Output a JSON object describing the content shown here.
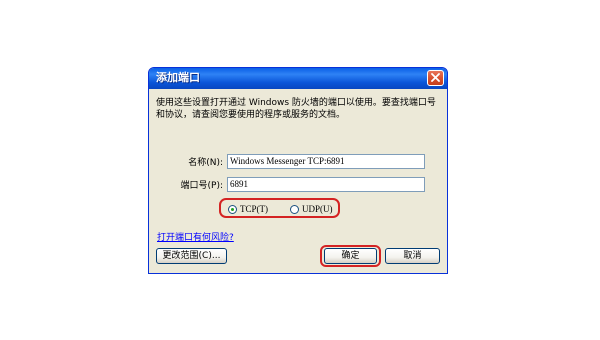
{
  "dialog": {
    "title": "添加端口",
    "description": "使用这些设置打开通过 Windows 防火墙的端口以使用。要查找端口号和协议，请查阅您要使用的程序或服务的文档。",
    "name_label": "名称(N):",
    "name_value": "Windows Messenger TCP:6891",
    "port_label": "端口号(P):",
    "port_value": "6891",
    "tcp_label": "TCP(T)",
    "udp_label": "UDP(U)",
    "selected_protocol": "TCP",
    "risk_link": "打开端口有何风险?",
    "change_scope_button": "更改范围(C)...",
    "ok_button": "确定",
    "cancel_button": "取消"
  },
  "colors": {
    "titlebar": "#0A5FE6",
    "dialog_bg": "#ECE9D8",
    "highlight": "#D42323",
    "link": "#0000FF"
  }
}
